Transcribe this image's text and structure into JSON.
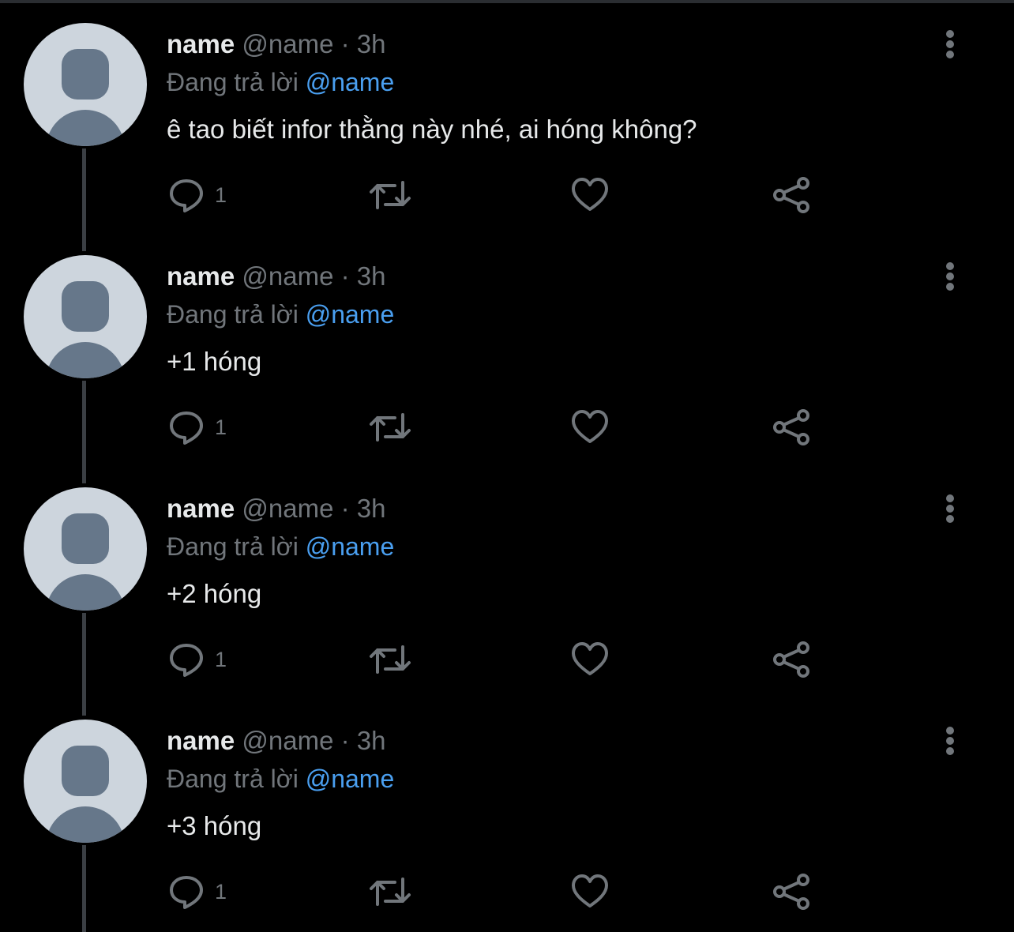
{
  "colors": {
    "background": "#000000",
    "primary_text": "#e7e9ea",
    "secondary_text": "#71767b",
    "mention": "#4a9ff0",
    "avatar_bg": "#cdd5dd",
    "avatar_fg": "#66778a"
  },
  "icons": {
    "reply": "speech-bubble-icon",
    "retweet": "retweet-icon",
    "like": "heart-icon",
    "share": "share-icon",
    "more": "vertical-dots-icon"
  },
  "replies": [
    {
      "display_name": "name",
      "handle": "@name",
      "separator": "·",
      "time": "3h",
      "replying_prefix": "Đang trả lời",
      "replying_to": "@name",
      "text": "ê tao biết infor thằng này nhé, ai hóng không?",
      "reply_count": "1"
    },
    {
      "display_name": "name",
      "handle": "@name",
      "separator": "·",
      "time": "3h",
      "replying_prefix": "Đang trả lời",
      "replying_to": "@name",
      "text": "+1 hóng",
      "reply_count": "1"
    },
    {
      "display_name": "name",
      "handle": "@name",
      "separator": "·",
      "time": "3h",
      "replying_prefix": "Đang trả lời",
      "replying_to": "@name",
      "text": "+2 hóng",
      "reply_count": "1"
    },
    {
      "display_name": "name",
      "handle": "@name",
      "separator": "·",
      "time": "3h",
      "replying_prefix": "Đang trả lời",
      "replying_to": "@name",
      "text": "+3 hóng",
      "reply_count": "1"
    }
  ]
}
